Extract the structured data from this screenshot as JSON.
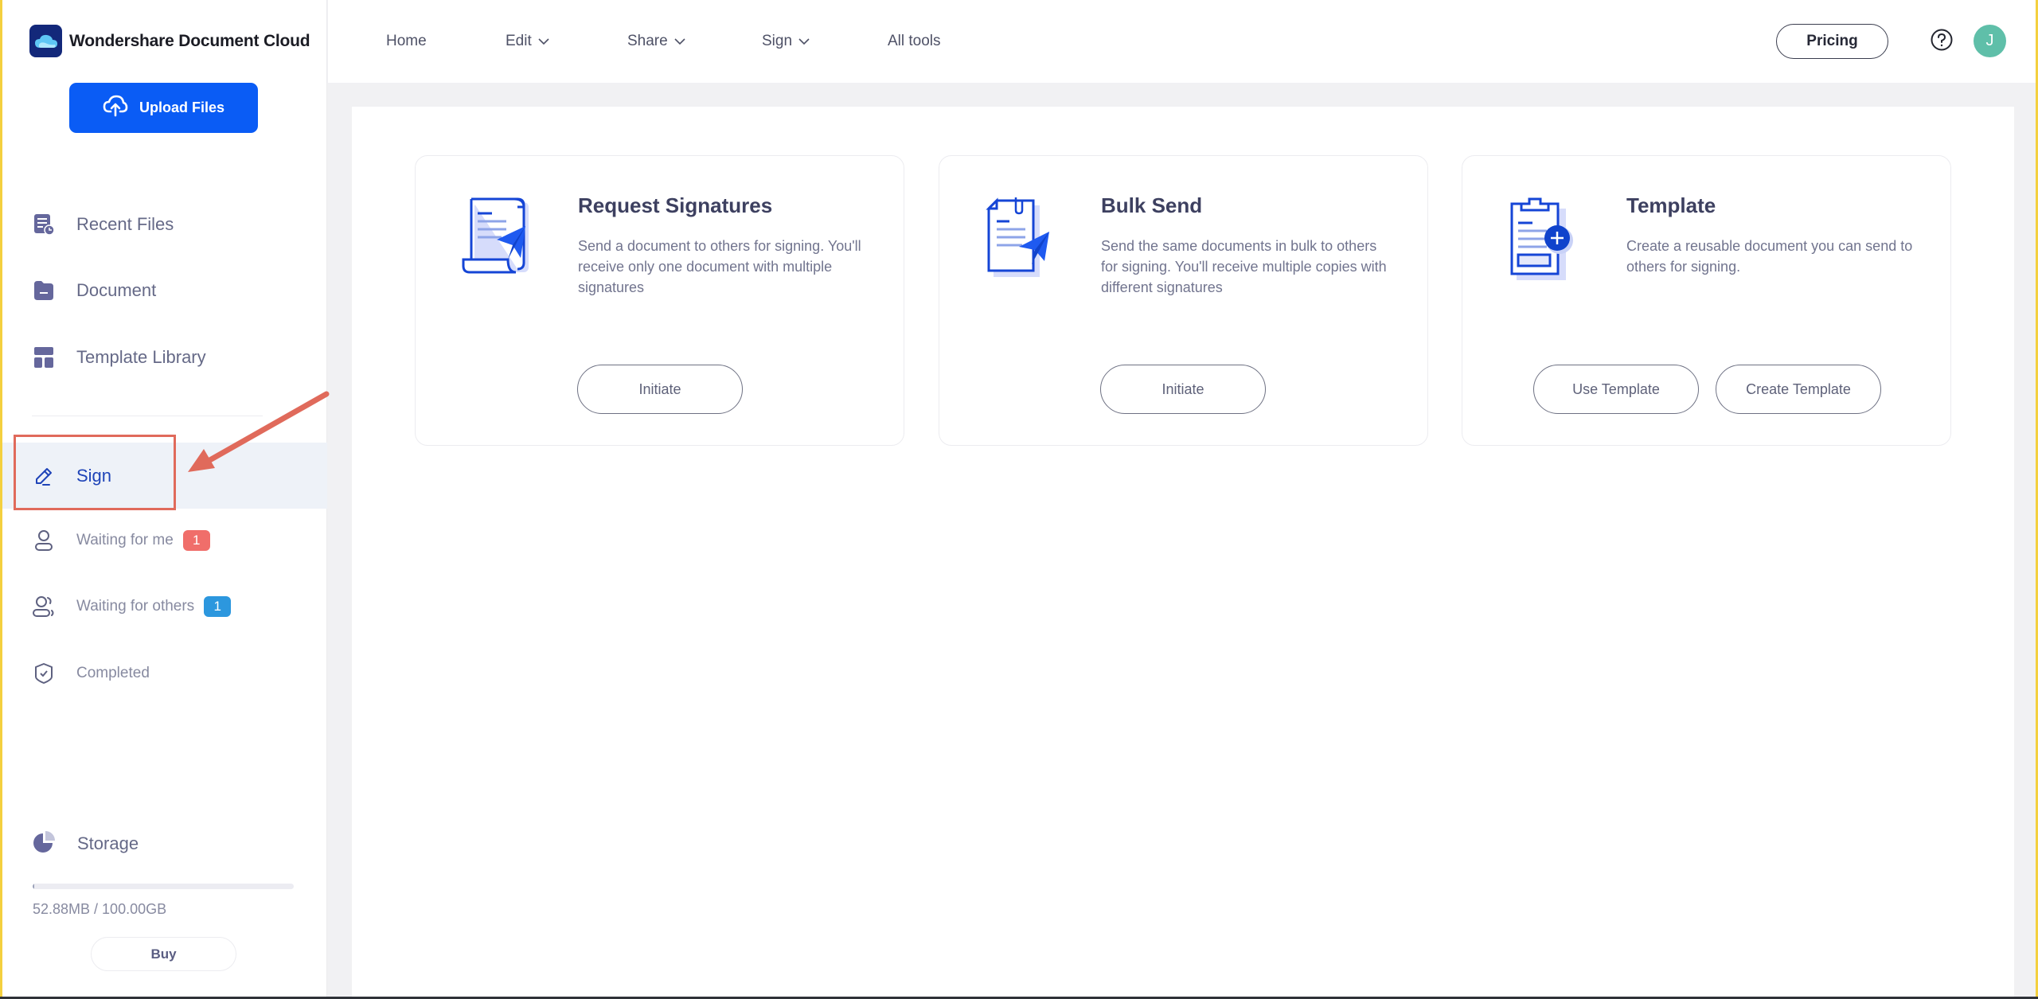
{
  "app": {
    "brand_name": "Wondershare Document Cloud",
    "upload_label": "Upload Files"
  },
  "sidebar": {
    "items": [
      {
        "label": "Recent Files",
        "icon": "recent-files-icon"
      },
      {
        "label": "Document",
        "icon": "folder-icon"
      },
      {
        "label": "Template Library",
        "icon": "template-library-icon"
      },
      {
        "label": "Sign",
        "icon": "pen-icon",
        "active": true
      },
      {
        "label": "Waiting for me",
        "icon": "person-icon",
        "badge": "1",
        "badge_color": "#f06e6a"
      },
      {
        "label": "Waiting for others",
        "icon": "people-icon",
        "badge": "1",
        "badge_color": "#2c97de"
      },
      {
        "label": "Completed",
        "icon": "shield-check-icon"
      }
    ],
    "storage": {
      "label": "Storage",
      "usage_text": "52.88MB / 100.00GB",
      "used_fraction": 0.0005,
      "buy_label": "Buy"
    }
  },
  "header": {
    "nav": [
      {
        "label": "Home",
        "dropdown": false
      },
      {
        "label": "Edit",
        "dropdown": true
      },
      {
        "label": "Share",
        "dropdown": true
      },
      {
        "label": "Sign",
        "dropdown": true
      },
      {
        "label": "All tools",
        "dropdown": false
      }
    ],
    "pricing_label": "Pricing",
    "avatar_initial": "J",
    "avatar_color": "#5fbfa9"
  },
  "cards": [
    {
      "title": "Request Signatures",
      "description": "Send a document to others for signing. You'll receive only one document with multiple signatures",
      "buttons": [
        "Initiate"
      ]
    },
    {
      "title": "Bulk Send",
      "description": "Send the same documents in bulk to others for signing. You'll receive multiple copies with different signatures",
      "buttons": [
        "Initiate"
      ]
    },
    {
      "title": "Template",
      "description": "Create a reusable document you can send to others for signing.",
      "buttons": [
        "Use Template",
        "Create Template"
      ]
    }
  ],
  "colors": {
    "accent": "#0a5cf5",
    "active_text": "#1f44b8",
    "annotation": "#e06a5b"
  }
}
